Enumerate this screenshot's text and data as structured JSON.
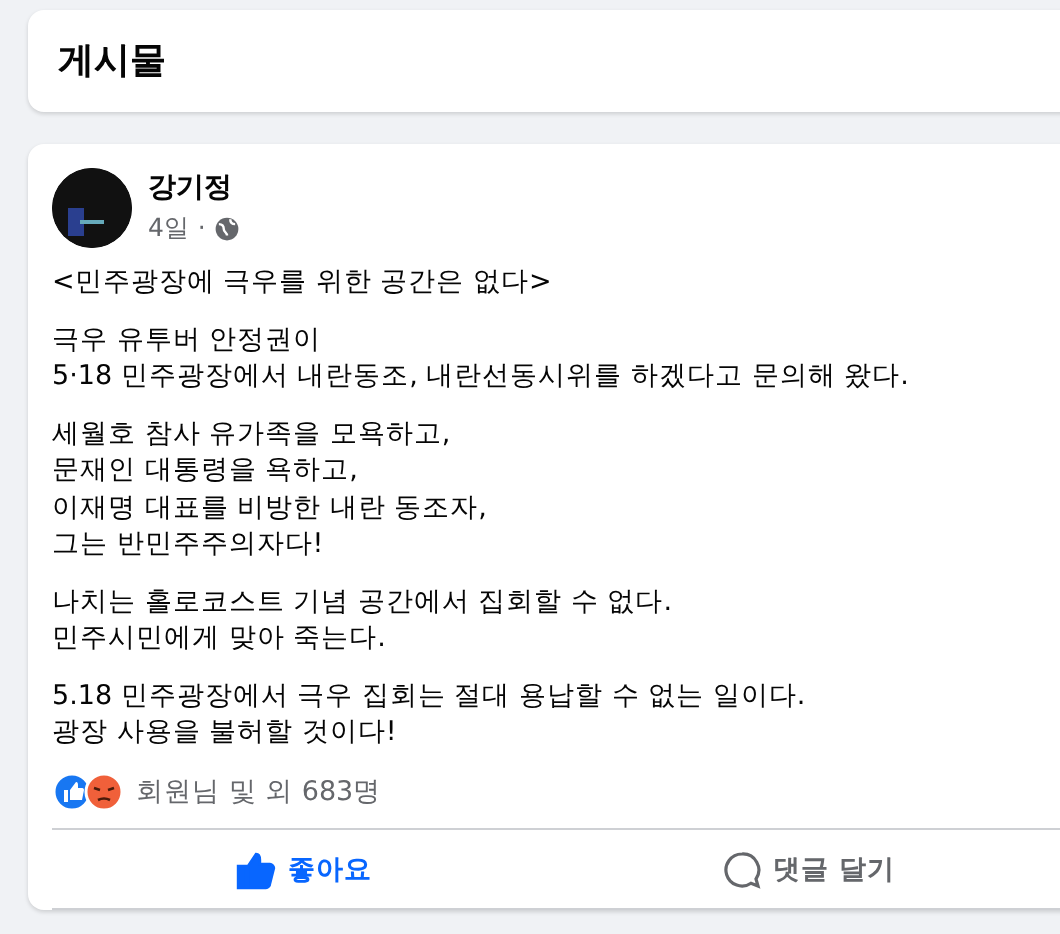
{
  "header": {
    "title": "게시물"
  },
  "post": {
    "author": "강기정",
    "time": "4일 ·",
    "paragraphs": [
      [
        "<민주광장에 극우를 위한 공간은 없다>"
      ],
      [
        "극우 유투버 안정권이",
        "5·18 민주광장에서 내란동조, 내란선동시위를 하겠다고 문의해 왔다."
      ],
      [
        "세월호 참사 유가족을 모욕하고,",
        "문재인 대통령을 욕하고,",
        "이재명 대표를 비방한 내란 동조자,",
        "그는 반민주주의자다!"
      ],
      [
        "나치는 홀로코스트 기념 공간에서 집회할 수 없다.",
        "민주시민에게 맞아 죽는다."
      ],
      [
        "5.18 민주광장에서 극우 집회는 절대 용납할 수 없는 일이다.",
        "광장 사용을 불허할 것이다!"
      ]
    ],
    "reactions": {
      "summary": "회원님 및 외 683명"
    },
    "actions": [
      {
        "kind": "like",
        "label": "좋아요",
        "selected": true
      },
      {
        "kind": "comment",
        "label": "댓글 달기",
        "selected": false
      }
    ]
  }
}
